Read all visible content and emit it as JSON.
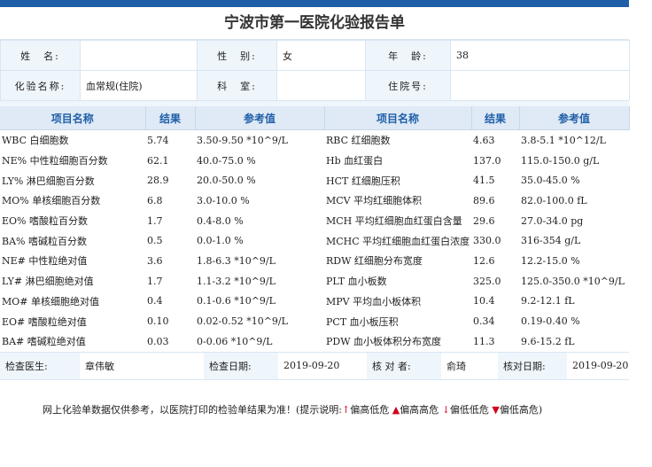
{
  "title": "宁波市第一医院化验报告单",
  "patient": {
    "name_label": "姓　名:",
    "name_value": "",
    "sex_label": "性　别:",
    "sex_value": "女",
    "age_label": "年　龄:",
    "age_value": "38",
    "test_label": "化验名称:",
    "test_value": "血常规(住院)",
    "dept_label": "科　室:",
    "dept_value": "",
    "ward_label": "住院号:",
    "ward_value": ""
  },
  "headers": [
    "项目名称",
    "结果",
    "参考值",
    "项目名称",
    "结果",
    "参考值"
  ],
  "rows": [
    {
      "l": {
        "name": "WBC 白细胞数",
        "result": "5.74",
        "ref": "3.50-9.50 *10^9/L"
      },
      "r": {
        "name": "RBC 红细胞数",
        "result": "4.63",
        "ref": "3.8-5.1 *10^12/L"
      }
    },
    {
      "l": {
        "name": "NE% 中性粒细胞百分数",
        "result": "62.1",
        "ref": "40.0-75.0 %"
      },
      "r": {
        "name": "Hb 血红蛋白",
        "result": "137.0",
        "ref": "115.0-150.0 g/L"
      }
    },
    {
      "l": {
        "name": "LY% 淋巴细胞百分数",
        "result": "28.9",
        "ref": "20.0-50.0 %"
      },
      "r": {
        "name": "HCT 红细胞压积",
        "result": "41.5",
        "ref": "35.0-45.0 %"
      }
    },
    {
      "l": {
        "name": "MO% 单核细胞百分数",
        "result": "6.8",
        "ref": "3.0-10.0 %"
      },
      "r": {
        "name": "MCV 平均红细胞体积",
        "result": "89.6",
        "ref": "82.0-100.0 fL"
      }
    },
    {
      "l": {
        "name": "EO% 嗜酸粒百分数",
        "result": "1.7",
        "ref": "0.4-8.0 %"
      },
      "r": {
        "name": "MCH 平均红细胞血红蛋白含量",
        "result": "29.6",
        "ref": "27.0-34.0 pg"
      }
    },
    {
      "l": {
        "name": "BA% 嗜碱粒百分数",
        "result": "0.5",
        "ref": "0.0-1.0 %"
      },
      "r": {
        "name": "MCHC 平均红细胞血红蛋白浓度",
        "result": "330.0",
        "ref": "316-354 g/L"
      }
    },
    {
      "l": {
        "name": "NE# 中性粒绝对值",
        "result": "3.6",
        "ref": "1.8-6.3 *10^9/L"
      },
      "r": {
        "name": "RDW 红细胞分布宽度",
        "result": "12.6",
        "ref": "12.2-15.0 %"
      }
    },
    {
      "l": {
        "name": "LY# 淋巴细胞绝对值",
        "result": "1.7",
        "ref": "1.1-3.2 *10^9/L"
      },
      "r": {
        "name": "PLT 血小板数",
        "result": "325.0",
        "ref": "125.0-350.0 *10^9/L"
      }
    },
    {
      "l": {
        "name": "MO# 单核细胞绝对值",
        "result": "0.4",
        "ref": "0.1-0.6 *10^9/L"
      },
      "r": {
        "name": "MPV 平均血小板体积",
        "result": "10.4",
        "ref": "9.2-12.1 fL"
      }
    },
    {
      "l": {
        "name": "EO# 嗜酸粒绝对值",
        "result": "0.10",
        "ref": "0.02-0.52 *10^9/L"
      },
      "r": {
        "name": "PCT 血小板压积",
        "result": "0.34",
        "ref": "0.19-0.40 %"
      }
    },
    {
      "l": {
        "name": "BA# 嗜碱粒绝对值",
        "result": "0.03",
        "ref": "0-0.06 *10^9/L"
      },
      "r": {
        "name": "PDW 血小板体积分布宽度",
        "result": "11.3",
        "ref": "9.6-15.2 fL"
      }
    }
  ],
  "footer": {
    "doctor_label": "检查医生:",
    "doctor_value": "章伟敏",
    "date_label": "检查日期:",
    "date_value": "2019-09-20",
    "checker_label": "核 对 者:",
    "checker_value": "俞琦",
    "check_date_label": "核对日期:",
    "check_date_value": "2019-09-20"
  },
  "note": {
    "text": "网上化验单数据仅供参考，以医院打印的检验单结果为准！(提示说明:",
    "up_arrow": "↑",
    "up_arrow_text": "偏高低危 ",
    "up_tri": "▲",
    "up_tri_text": "偏高高危 ",
    "down_arrow": "↓",
    "down_arrow_text": "偏低低危 ",
    "down_tri": "▼",
    "down_tri_text": "偏低高危)"
  },
  "colors": {
    "accent": "#1f5fa8",
    "label_bg": "#eef5fb",
    "header_bg": "#dfeaf6",
    "alert": "#d0021b"
  }
}
